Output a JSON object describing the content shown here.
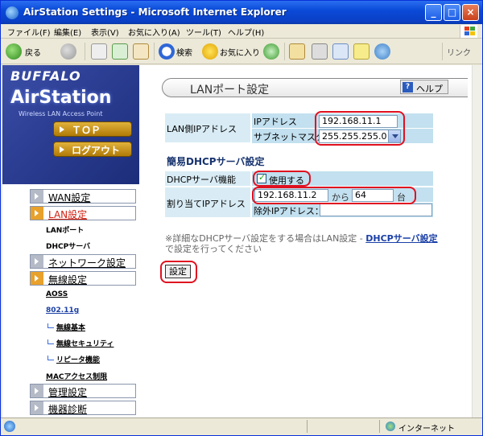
{
  "window": {
    "title": "AirStation Settings - Microsoft Internet Explorer",
    "minimize": "_",
    "maximize": "□",
    "close": "×"
  },
  "menu": [
    "ファイル(F)",
    "編集(E)",
    "表示(V)",
    "お気に入り(A)",
    "ツール(T)",
    "ヘルプ(H)"
  ],
  "toolbar": {
    "back": "戻る",
    "search": "検索",
    "favorites": "お気に入り",
    "links": "リンク"
  },
  "sidebar": {
    "brand": "BUFFALO",
    "product": "AirStation",
    "tagline": "Wireless LAN Access Point",
    "top_button": "ＴＯＰ",
    "logout_button": "ログアウト",
    "wan": "WAN設定",
    "lan": "LAN設定",
    "lanport": "LANポート",
    "dhcp": "DHCPサーバ",
    "network": "ネットワーク設定",
    "wireless": "無線設定",
    "aoss": "AOSS",
    "dot11g": "802.11g",
    "wl_basic": "無線基本",
    "wl_security": "無線セキュリティ",
    "repeater": "リピータ機能",
    "mac": "MACアクセス制限",
    "admin": "管理設定",
    "diag": "機器診断"
  },
  "main": {
    "page_title": "LANポート設定",
    "help": "ヘルプ",
    "lan_ip_label": "LAN側IPアドレス",
    "ip_label": "IPアドレス",
    "ip_value": "192.168.11.1",
    "subnet_label": "サブネットマスク",
    "subnet_value": "255.255.255.0",
    "dhcp_section": "簡易DHCPサーバ設定",
    "dhcp_func_label": "DHCPサーバ機能",
    "dhcp_use": "使用する",
    "assign_label": "割り当てIPアドレス",
    "assign_start": "192.168.11.2",
    "from": "から",
    "count": "64",
    "unit": "台",
    "exclude_label": "除外IPアドレス：",
    "exclude_value": "",
    "note_prefix": "※詳細なDHCPサーバ設定をする場合はLAN設定 - ",
    "note_link": "DHCPサーバ設定",
    "note_suffix": "で設定を行ってください",
    "set_button": "設定"
  },
  "status": {
    "zone": "インターネット"
  },
  "colors": {
    "title_bar": "#0a4ad8",
    "sidebar_panel": "#2d3f94",
    "highlight": "#e01020",
    "table_cell": "#d9ecf5"
  }
}
